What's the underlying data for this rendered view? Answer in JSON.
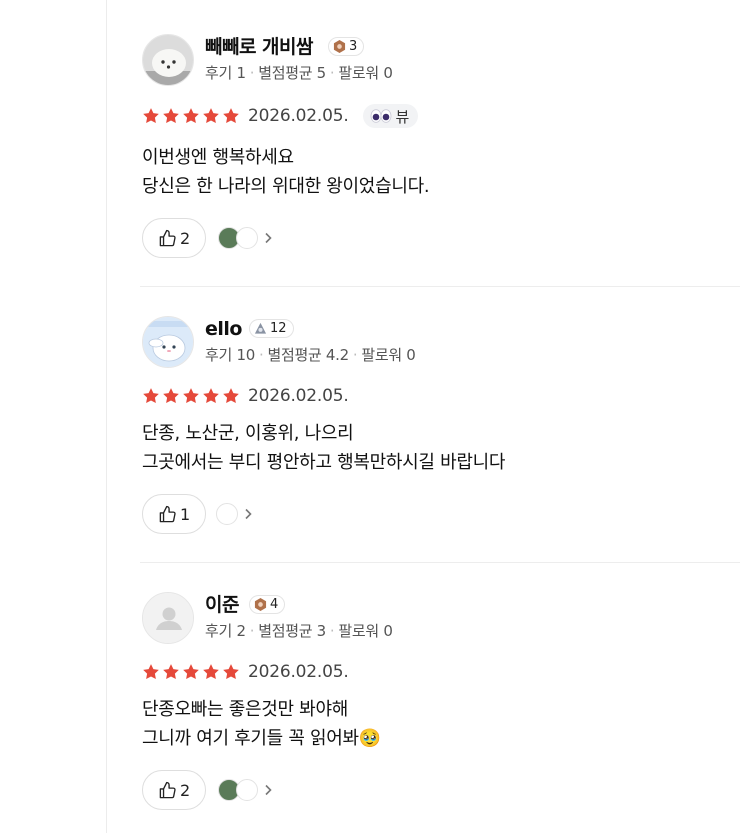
{
  "reviews": [
    {
      "name": "빼빼로 개비쌈",
      "badge": "3",
      "meta_reviews": "후기 1",
      "meta_avg": "별점평균 5",
      "meta_followers": "팔로워 0",
      "rating": 5,
      "date": "2026.02.05.",
      "tag": "뷰",
      "tag_icon": "eyes-emoji",
      "lines": [
        "이번생엔 행복하세요",
        "당신은 한 나라의 위대한 왕이었습니다."
      ],
      "likes": "2",
      "avatar": "dog-photo"
    },
    {
      "name": "ello",
      "badge": "12",
      "meta_reviews": "후기 10",
      "meta_avg": "별점평균 4.2",
      "meta_followers": "팔로워 0",
      "rating": 5,
      "date": "2026.02.05.",
      "lines": [
        "단종, 노산군, 이홍위, 나으리",
        "그곳에서는 부디 평안하고 행복만하시길 바랍니다"
      ],
      "likes": "1",
      "avatar": "cinnamoroll-character"
    },
    {
      "name": "이준",
      "badge": "4",
      "meta_reviews": "후기 2",
      "meta_avg": "별점평균 3",
      "meta_followers": "팔로워 0",
      "rating": 5,
      "date": "2026.02.05.",
      "lines": [
        "단종오빠는 좋은것만 봐야해",
        "그니까 여기 후기들 꼭 읽어봐🥹"
      ],
      "likes": "2",
      "avatar": "default-person"
    }
  ],
  "colors": {
    "star": "#e5493a",
    "badge_bronze": "#b0714a",
    "badge_gray": "#8a93a3"
  }
}
